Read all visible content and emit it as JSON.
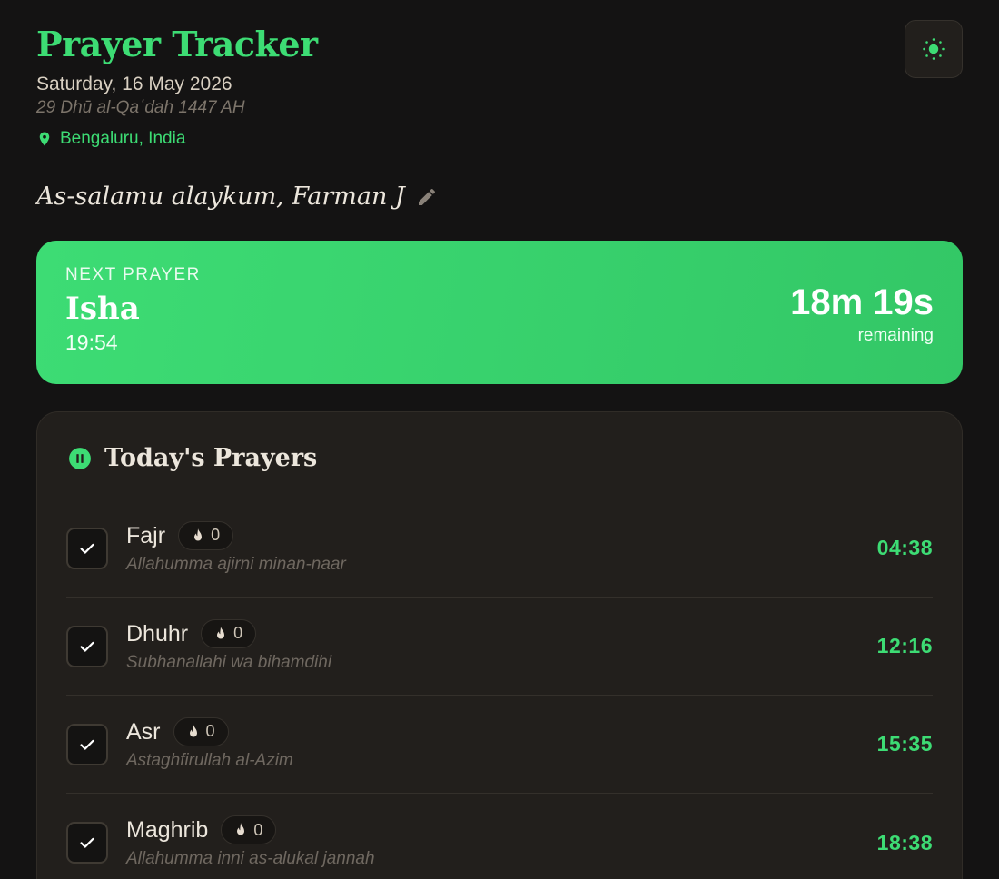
{
  "header": {
    "title": "Prayer Tracker",
    "gregorian_date": "Saturday, 16 May 2026",
    "hijri_date": "29 Dhū al-Qaʿdah 1447 AH",
    "location": "Bengaluru, India",
    "theme_icon": "sun-icon"
  },
  "greeting": {
    "text": "As-salamu alaykum, Farman J",
    "edit_icon": "pencil-icon"
  },
  "next_prayer": {
    "label": "NEXT PRAYER",
    "name": "Isha",
    "time": "19:54",
    "countdown": "18m 19s",
    "countdown_label": "remaining"
  },
  "prayers_panel": {
    "title": "Today's Prayers",
    "icon": "pause-circle-icon",
    "prayers": [
      {
        "name": "Fajr",
        "streak": "0",
        "dua": "Allahumma ajirni minan-naar",
        "time": "04:38",
        "checked": true
      },
      {
        "name": "Dhuhr",
        "streak": "0",
        "dua": "Subhanallahi wa bihamdihi",
        "time": "12:16",
        "checked": true
      },
      {
        "name": "Asr",
        "streak": "0",
        "dua": "Astaghfirullah al-Azim",
        "time": "15:35",
        "checked": true
      },
      {
        "name": "Maghrib",
        "streak": "0",
        "dua": "Allahumma inni as-alukal jannah",
        "time": "18:38",
        "checked": true
      }
    ]
  },
  "colors": {
    "accent": "#3ddc74",
    "background": "#141313",
    "panel": "#221f1c",
    "muted_text": "#6f6860"
  }
}
